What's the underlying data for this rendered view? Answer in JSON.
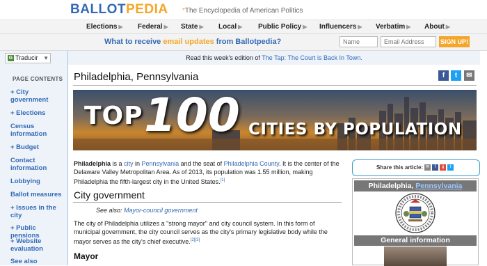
{
  "brand": {
    "part1": "BALLOT",
    "part2": "PEDIA",
    "tagline_star": "*",
    "tagline": "The Encyclopedia of American Politics",
    "colors": {
      "blue": "#3369b4",
      "orange": "#f4a62a"
    }
  },
  "nav": {
    "items": [
      "Elections",
      "Federal",
      "State",
      "Local",
      "Public Policy",
      "Influencers",
      "Verbatim",
      "About"
    ],
    "arrow": "▶"
  },
  "signup": {
    "prompt_pre": "What to receive ",
    "prompt_hl": "email updates",
    "prompt_post": " from Ballotpedia?",
    "name_placeholder": "Name",
    "email_placeholder": "Email Address",
    "button": "SIGN UP!"
  },
  "sidebar": {
    "translate_label": "Traducir",
    "toc_title": "PAGE CONTENTS",
    "items": [
      "+ City government",
      "+ Elections",
      "Census information",
      "+ Budget",
      "Contact information",
      "Lobbying",
      "Ballot measures",
      "+ Issues in the city",
      "+ Public pensions",
      "+ Website evaluation",
      "See also"
    ]
  },
  "notice": {
    "pre": "Read this week's edition of ",
    "link": "The Tap: The Court is Back In Town."
  },
  "page": {
    "title": "Philadelphia, Pennsylvania"
  },
  "banner": {
    "top": "TOP",
    "num": "100",
    "sub": "CITIES BY POPULATION"
  },
  "intro": {
    "p1_bold": "Philadelphia",
    "p1_a": " is a ",
    "p1_link1": "city",
    "p1_b": " in ",
    "p1_link2": "Pennsylvania",
    "p1_c": " and the seat of ",
    "p1_link3": "Philadelphia County",
    "p1_d": ". It is the center of the Delaware Valley Metropolitan Area. As of 2013, its population was 1.55 million, making Philadelphia the fifth-largest city in the United States.",
    "p1_ref": "[1]"
  },
  "city_government": {
    "heading": "City government",
    "see_also_label": "See also: ",
    "see_also_link": "Mayor-council government",
    "text": "The city of Philadelphia utilizes a \"strong mayor\" and city council system. In this form of municipal government, the city council serves as the city's primary legislative body while the mayor serves as the city's chief executive.",
    "refs": "[2][3]"
  },
  "mayor_heading": "Mayor",
  "share": {
    "label": "Share this article:"
  },
  "infobox": {
    "title_pre": "Philadelphia, ",
    "title_link": "Pennsylvania",
    "section": "General information"
  }
}
